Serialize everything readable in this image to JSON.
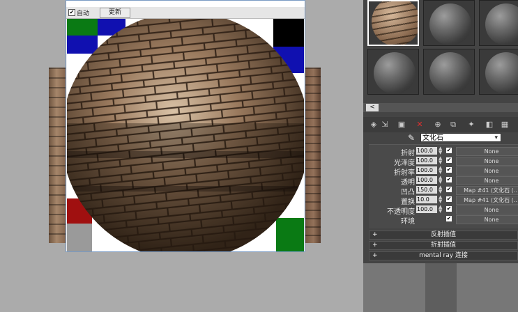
{
  "preview": {
    "auto_label": "自动",
    "auto_checked": "✔",
    "update_label": "更新"
  },
  "editor": {
    "scroll_left": "<",
    "material_name": "文化石",
    "dropdown_arrow": "▾",
    "toolbar_icons": [
      "pick-material-icon",
      "put-to-scene-icon",
      "assign-material-icon",
      "delete-icon",
      "make-unique-icon",
      "copy-material-icon",
      "show-map-icon",
      "show-end-result-icon",
      "background-icon"
    ],
    "params": [
      {
        "label": "折射",
        "value": "100.0",
        "map": "None"
      },
      {
        "label": "光泽度",
        "value": "100.0",
        "map": "None"
      },
      {
        "label": "折射率",
        "value": "100.0",
        "map": "None"
      },
      {
        "label": "透明",
        "value": "100.0",
        "map": "None"
      },
      {
        "label": "凹凸",
        "value": "150.0",
        "map": "Map #41 (文化石 (…"
      },
      {
        "label": "置换",
        "value": "10.0",
        "map": "Map #41 (文化石 (…"
      },
      {
        "label": "不透明度",
        "value": "100.0",
        "map": "None"
      },
      {
        "label": "环境",
        "value": "",
        "map": "None"
      }
    ],
    "rollouts": [
      {
        "plus": "+",
        "title": "反射插值"
      },
      {
        "plus": "+",
        "title": "折射插值"
      },
      {
        "plus": "+",
        "title": "mental ray 连接"
      }
    ]
  },
  "colors": {
    "background": "#ababab",
    "panel": "#444444",
    "accent_border": "#7a9bc4"
  }
}
